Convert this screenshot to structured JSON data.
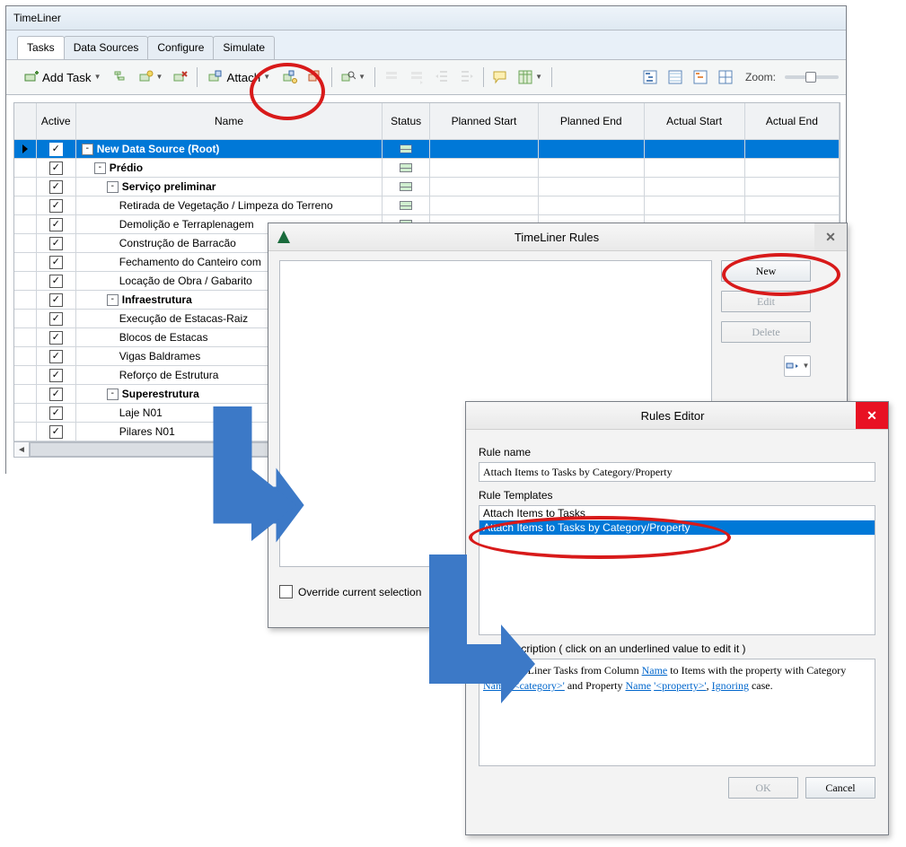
{
  "main": {
    "title": "TimeLiner",
    "tabs": [
      "Tasks",
      "Data Sources",
      "Configure",
      "Simulate"
    ],
    "activeTab": 0,
    "toolbar": {
      "addTask": "Add Task",
      "attach": "Attach",
      "zoomLabel": "Zoom:"
    },
    "columns": {
      "active": "Active",
      "name": "Name",
      "status": "Status",
      "plannedStart": "Planned Start",
      "plannedEnd": "Planned End",
      "actualStart": "Actual Start",
      "actualEnd": "Actual End"
    },
    "rows": [
      {
        "indent": 0,
        "exp": "-",
        "bold": true,
        "name": "New Data Source (Root)",
        "sel": true,
        "marker": true,
        "status": true
      },
      {
        "indent": 1,
        "exp": "-",
        "bold": true,
        "name": "Prédio",
        "status": true
      },
      {
        "indent": 2,
        "exp": "-",
        "bold": true,
        "name": "Serviço preliminar",
        "status": true
      },
      {
        "indent": 3,
        "name": "Retirada de Vegetação / Limpeza do Terreno",
        "status": true
      },
      {
        "indent": 3,
        "name": "Demolição e Terraplenagem",
        "status": true
      },
      {
        "indent": 3,
        "name": "Construção de Barracão",
        "status": true
      },
      {
        "indent": 3,
        "name": "Fechamento do Canteiro com",
        "status": true
      },
      {
        "indent": 3,
        "name": "Locação de Obra / Gabarito",
        "status": true
      },
      {
        "indent": 2,
        "exp": "-",
        "bold": true,
        "name": "Infraestrutura",
        "status": true
      },
      {
        "indent": 3,
        "name": "Execução de Estacas-Raiz"
      },
      {
        "indent": 3,
        "name": "Blocos de Estacas"
      },
      {
        "indent": 3,
        "name": "Vigas Baldrames"
      },
      {
        "indent": 3,
        "name": "Reforço de Estrutura"
      },
      {
        "indent": 2,
        "exp": "-",
        "bold": true,
        "name": "Superestrutura"
      },
      {
        "indent": 3,
        "name": "Laje N01"
      },
      {
        "indent": 3,
        "name": "Pilares N01"
      }
    ]
  },
  "rules1": {
    "title": "TimeLiner Rules",
    "buttons": {
      "new": "New",
      "edit": "Edit",
      "delete": "Delete"
    },
    "override": "Override current selection"
  },
  "rules2": {
    "title": "Rules Editor",
    "ruleNameLabel": "Rule name",
    "ruleNameValue": "Attach Items to Tasks by Category/Property",
    "templatesLabel": "Rule Templates",
    "templates": [
      {
        "text": "Attach Items to Tasks",
        "sel": false
      },
      {
        "text": "Attach Items to Tasks by Category/Property",
        "sel": true
      }
    ],
    "descLabel": "Rule description ( click on an underlined value to edit it )",
    "descParts": {
      "p1": "Map TimeLiner Tasks from Column ",
      "l1": "Name",
      "p2": " to Items with the property with Category ",
      "l2": "Name",
      "p3": " ",
      "l3": "'<category>'",
      "p4": " and Property ",
      "l4": "Name",
      "p5": " ",
      "l5": "'<property>'",
      "p6": ", ",
      "l6": "Ignoring",
      "p7": " case."
    },
    "ok": "OK",
    "cancel": "Cancel"
  }
}
